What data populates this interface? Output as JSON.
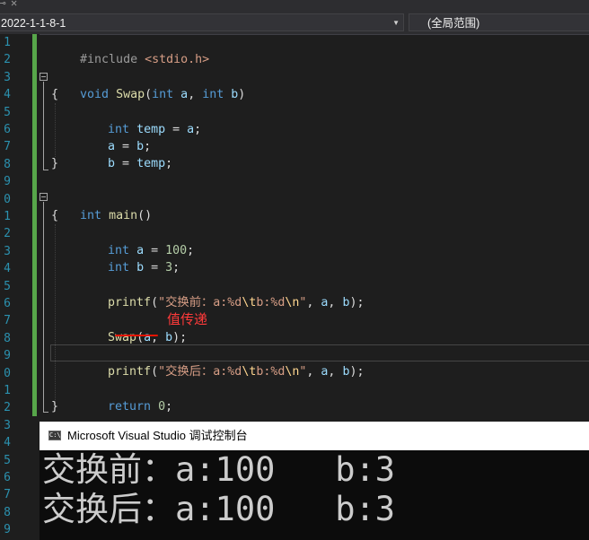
{
  "tabstrip": {
    "pin_glyph": "⊸",
    "close_glyph": "✕"
  },
  "navbar": {
    "project_scope": "2022-1-1-8-1",
    "member_scope": "(全局范围)",
    "dropdown_arrow": "▼"
  },
  "line_numbers": [
    "1",
    "2",
    "3",
    "4",
    "5",
    "6",
    "7",
    "8",
    "9",
    "0",
    "1",
    "2",
    "3",
    "4",
    "5",
    "6",
    "7",
    "8",
    "9",
    "0",
    "1",
    "2",
    "3",
    "4",
    "5",
    "6",
    "7",
    "8",
    "9"
  ],
  "code": {
    "l1": {
      "pp": "#include ",
      "hdr": "<stdio.h>"
    },
    "l3": {
      "kw": "void",
      "fn": "Swap",
      "p1": "(",
      "t1": "int",
      "a": "a",
      "p2": ", ",
      "t2": "int",
      "b": "b",
      "p3": ")"
    },
    "l4": "{",
    "l5": {
      "kw": "int",
      "v": "temp",
      "rest": " = ",
      "a": "a",
      "end": ";"
    },
    "l6": {
      "a": "a",
      "mid": " = ",
      "b": "b",
      "end": ";"
    },
    "l7": {
      "b": "b",
      "mid": " = ",
      "temp": "temp",
      "end": ";"
    },
    "l8": "}",
    "l10": {
      "kw": "int",
      "fn": "main",
      "rest": "()"
    },
    "l11": "{",
    "l12": {
      "kw": "int",
      "v": "a",
      "mid": " = ",
      "num": "100",
      "end": ";"
    },
    "l13": {
      "kw": "int",
      "v": "b",
      "mid": " = ",
      "num": "3",
      "end": ";"
    },
    "l15": {
      "fn": "printf",
      "open": "(",
      "s1": "\"交换前：a:%d",
      "esc1": "\\t",
      "s2": "b:%d",
      "esc2": "\\n",
      "s3": "\"",
      "mid": ", ",
      "a": "a",
      "comma": ", ",
      "b": "b",
      "end": ");"
    },
    "l17": {
      "fn": "Swap",
      "open": "(",
      "a": "a",
      "comma": ", ",
      "b": "b",
      "end": ");"
    },
    "l19": {
      "fn": "printf",
      "open": "(",
      "s1": "\"交换后：a:%d",
      "esc1": "\\t",
      "s2": "b:%d",
      "esc2": "\\n",
      "s3": "\"",
      "mid": ", ",
      "a": "a",
      "comma": ", ",
      "b": "b",
      "end": ");"
    },
    "l21": {
      "kw": "return",
      "rest": " ",
      "num": "0",
      "end": ";"
    },
    "l22": "}"
  },
  "annotation": {
    "text": "值传递",
    "color": "#ff3a3a"
  },
  "console": {
    "icon_text": "C:\\",
    "title": "Microsoft Visual Studio 调试控制台",
    "output": [
      "交换前：a:100   b:3",
      "交换后：a:100   b:3"
    ]
  },
  "colors": {
    "editor_bg": "#1e1e1e",
    "keyword": "#569cd6",
    "function": "#dcdcaa",
    "string": "#d69d85",
    "number": "#b5cea8",
    "line_number": "#2b91af",
    "change_margin": "#57a64a",
    "squiggle": "#e51400"
  }
}
